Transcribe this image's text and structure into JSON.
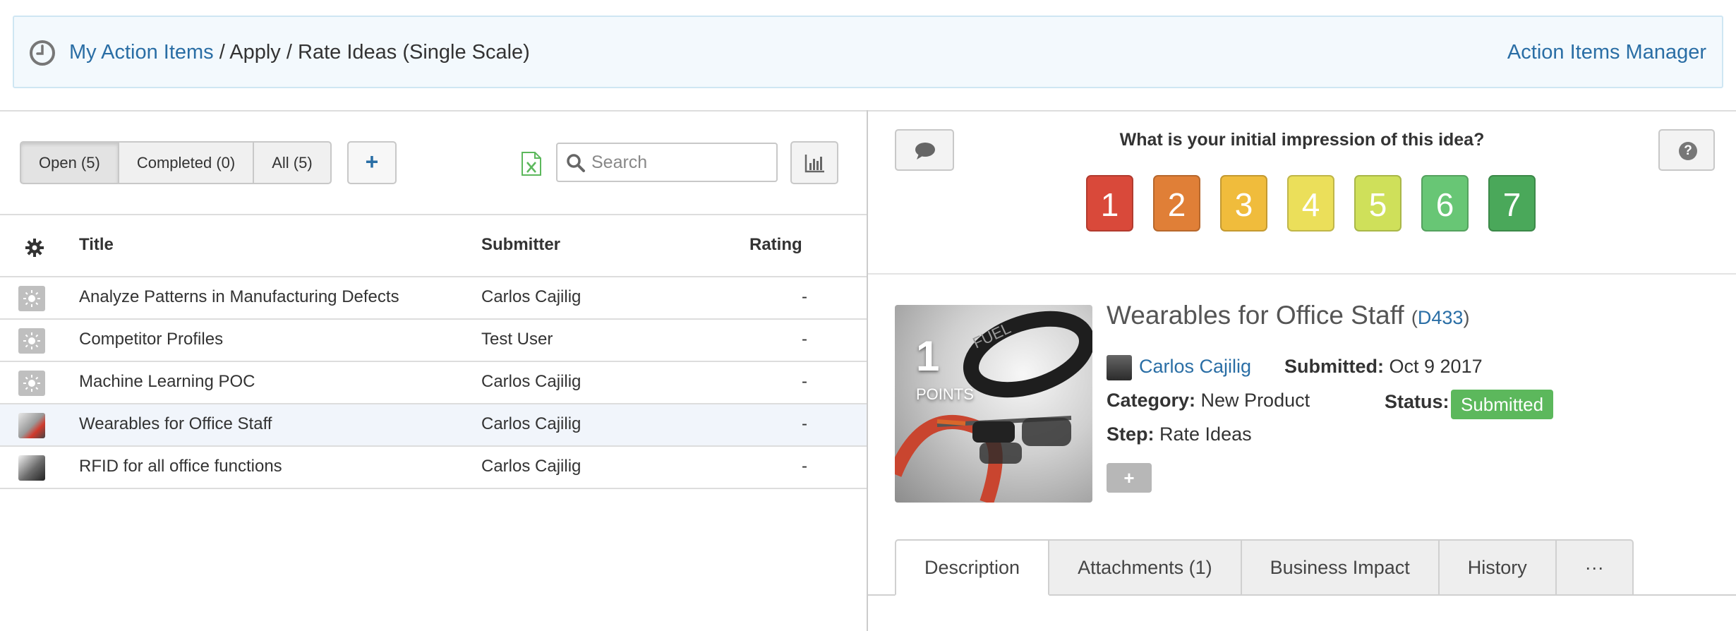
{
  "breadcrumb": {
    "home": "My Action Items",
    "separator": "/",
    "section": "Apply",
    "current": "Rate Ideas (Single Scale)"
  },
  "header": {
    "manager_link": "Action Items Manager"
  },
  "toolbar": {
    "filters": [
      {
        "label": "Open (5)",
        "active": true
      },
      {
        "label": "Completed (0)",
        "active": false
      },
      {
        "label": "All (5)",
        "active": false
      }
    ],
    "add_label": "+",
    "search_placeholder": "Search"
  },
  "table": {
    "columns": {
      "title": "Title",
      "submitter": "Submitter",
      "rating": "Rating"
    },
    "rows": [
      {
        "thumb": "lightbulb-icon",
        "title": "Analyze Patterns in Manufacturing Defects",
        "submitter": "Carlos Cajilig",
        "rating": "-"
      },
      {
        "thumb": "lightbulb-icon",
        "title": "Competitor Profiles",
        "submitter": "Test User",
        "rating": "-"
      },
      {
        "thumb": "lightbulb-icon",
        "title": "Machine Learning POC",
        "submitter": "Carlos Cajilig",
        "rating": "-"
      },
      {
        "thumb": "wearables-photo",
        "title": "Wearables for Office Staff",
        "submitter": "Carlos Cajilig",
        "rating": "-",
        "selected": true
      },
      {
        "thumb": "rfid-photo",
        "title": "RFID for all office functions",
        "submitter": "Carlos Cajilig",
        "rating": "-"
      }
    ]
  },
  "rating": {
    "question": "What is your initial impression of this idea?",
    "scale": [
      {
        "value": "1",
        "color": "#d9493a"
      },
      {
        "value": "2",
        "color": "#e07f37"
      },
      {
        "value": "3",
        "color": "#f0bc3c"
      },
      {
        "value": "4",
        "color": "#ebdf5a"
      },
      {
        "value": "5",
        "color": "#cfe05a"
      },
      {
        "value": "6",
        "color": "#68c675"
      },
      {
        "value": "7",
        "color": "#4aa85a"
      }
    ]
  },
  "idea": {
    "title": "Wearables for Office Staff",
    "code": "D433",
    "points": "1",
    "points_label": "POINTS",
    "author": "Carlos Cajilig",
    "submitted_label": "Submitted:",
    "submitted_value": "Oct 9 2017",
    "category_label": "Category:",
    "category_value": "New Product",
    "status_label": "Status:",
    "status_value": "Submitted",
    "step_label": "Step:",
    "step_value": "Rate Ideas",
    "add_label": "+",
    "image_text": "FUEL"
  },
  "tabs": [
    {
      "label": "Description",
      "active": true
    },
    {
      "label": "Attachments (1)",
      "active": false
    },
    {
      "label": "Business Impact",
      "active": false
    },
    {
      "label": "History",
      "active": false
    },
    {
      "label": "···",
      "active": false
    }
  ]
}
